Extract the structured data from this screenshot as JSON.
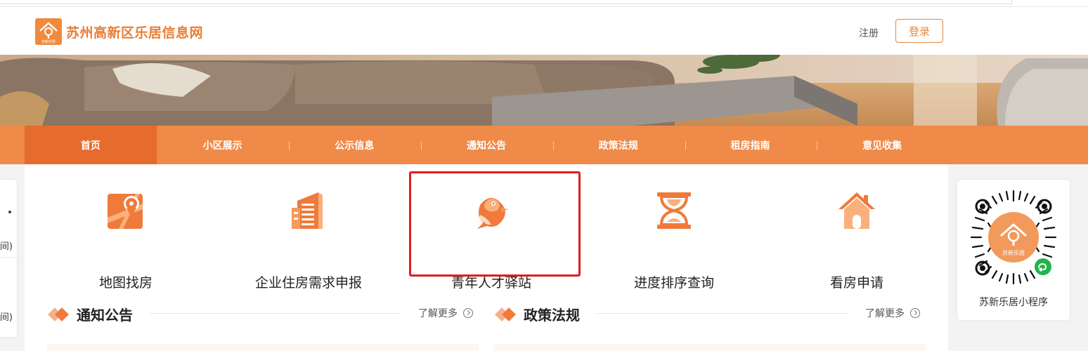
{
  "site": {
    "title": "苏州高新区乐居信息网",
    "logo_caption": "苏新乐居"
  },
  "header": {
    "register_label": "注册",
    "login_label": "登录"
  },
  "nav": {
    "items": [
      {
        "label": "首页",
        "active": true
      },
      {
        "label": "小区展示"
      },
      {
        "label": "公示信息"
      },
      {
        "label": "通知公告"
      },
      {
        "label": "政策法规"
      },
      {
        "label": "租房指南"
      },
      {
        "label": "意见收集"
      }
    ]
  },
  "services": [
    {
      "label": "地图找房",
      "icon": "map-pin-icon"
    },
    {
      "label": "企业住房需求申报",
      "icon": "building-icon"
    },
    {
      "label": "青年人才驿站",
      "icon": "bird-icon"
    },
    {
      "label": "进度排序查询",
      "icon": "hourglass-icon"
    },
    {
      "label": "看房申请",
      "icon": "house-icon"
    }
  ],
  "sections": {
    "notice": {
      "title": "通知公告",
      "more": "了解更多"
    },
    "policy": {
      "title": "政策法规",
      "more": "了解更多"
    }
  },
  "side_left": {
    "text1": "间)",
    "text2": "间)"
  },
  "mini_program": {
    "caption": "苏新乐居小程序",
    "qr_label": "苏新乐居"
  },
  "colors": {
    "brand": "#ef8a49",
    "active": "#e56c2c",
    "highlight": "#e01d1d"
  }
}
